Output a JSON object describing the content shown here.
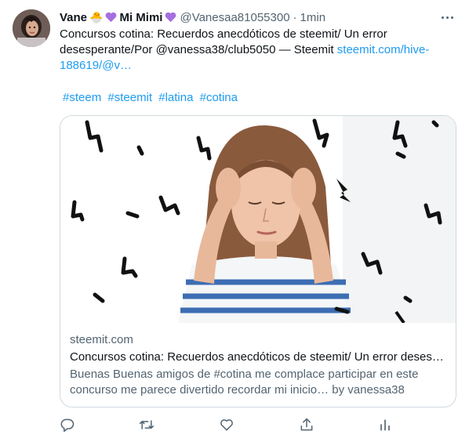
{
  "author": {
    "display_name": "Vane",
    "name_suffix": "Mi Mimi",
    "chick_emoji": "🐣",
    "handle": "@Vanesaa81055300",
    "separator": "·",
    "time": "1min"
  },
  "tweet": {
    "text": "Concursos cotina: Recuerdos anecdóticos de steemit/  Un error desesperante/Por @vanessa38/club5050 — Steemit ",
    "link": "steemit.com/hive-188619/@v…",
    "hashtags": [
      "#steem",
      "#steemit",
      "#latina",
      "#cotina"
    ]
  },
  "card": {
    "domain": "steemit.com",
    "title": "Concursos cotina: Recuerdos anecdóticos de steemit/ Un error deses…",
    "description": "Buenas Buenas amigos de #cotina me complace participar en este concurso me parece divertido recordar mi inicio… by vanessa38"
  },
  "actions": {
    "reply_icon": "reply-icon",
    "retweet_icon": "retweet-icon",
    "like_icon": "like-icon",
    "share_icon": "share-icon",
    "analytics_icon": "analytics-icon"
  },
  "colors": {
    "link": "#1d9bf0",
    "secondary_text": "#536471",
    "border": "#cfd9de",
    "heart_purple": "#a66ee0"
  }
}
